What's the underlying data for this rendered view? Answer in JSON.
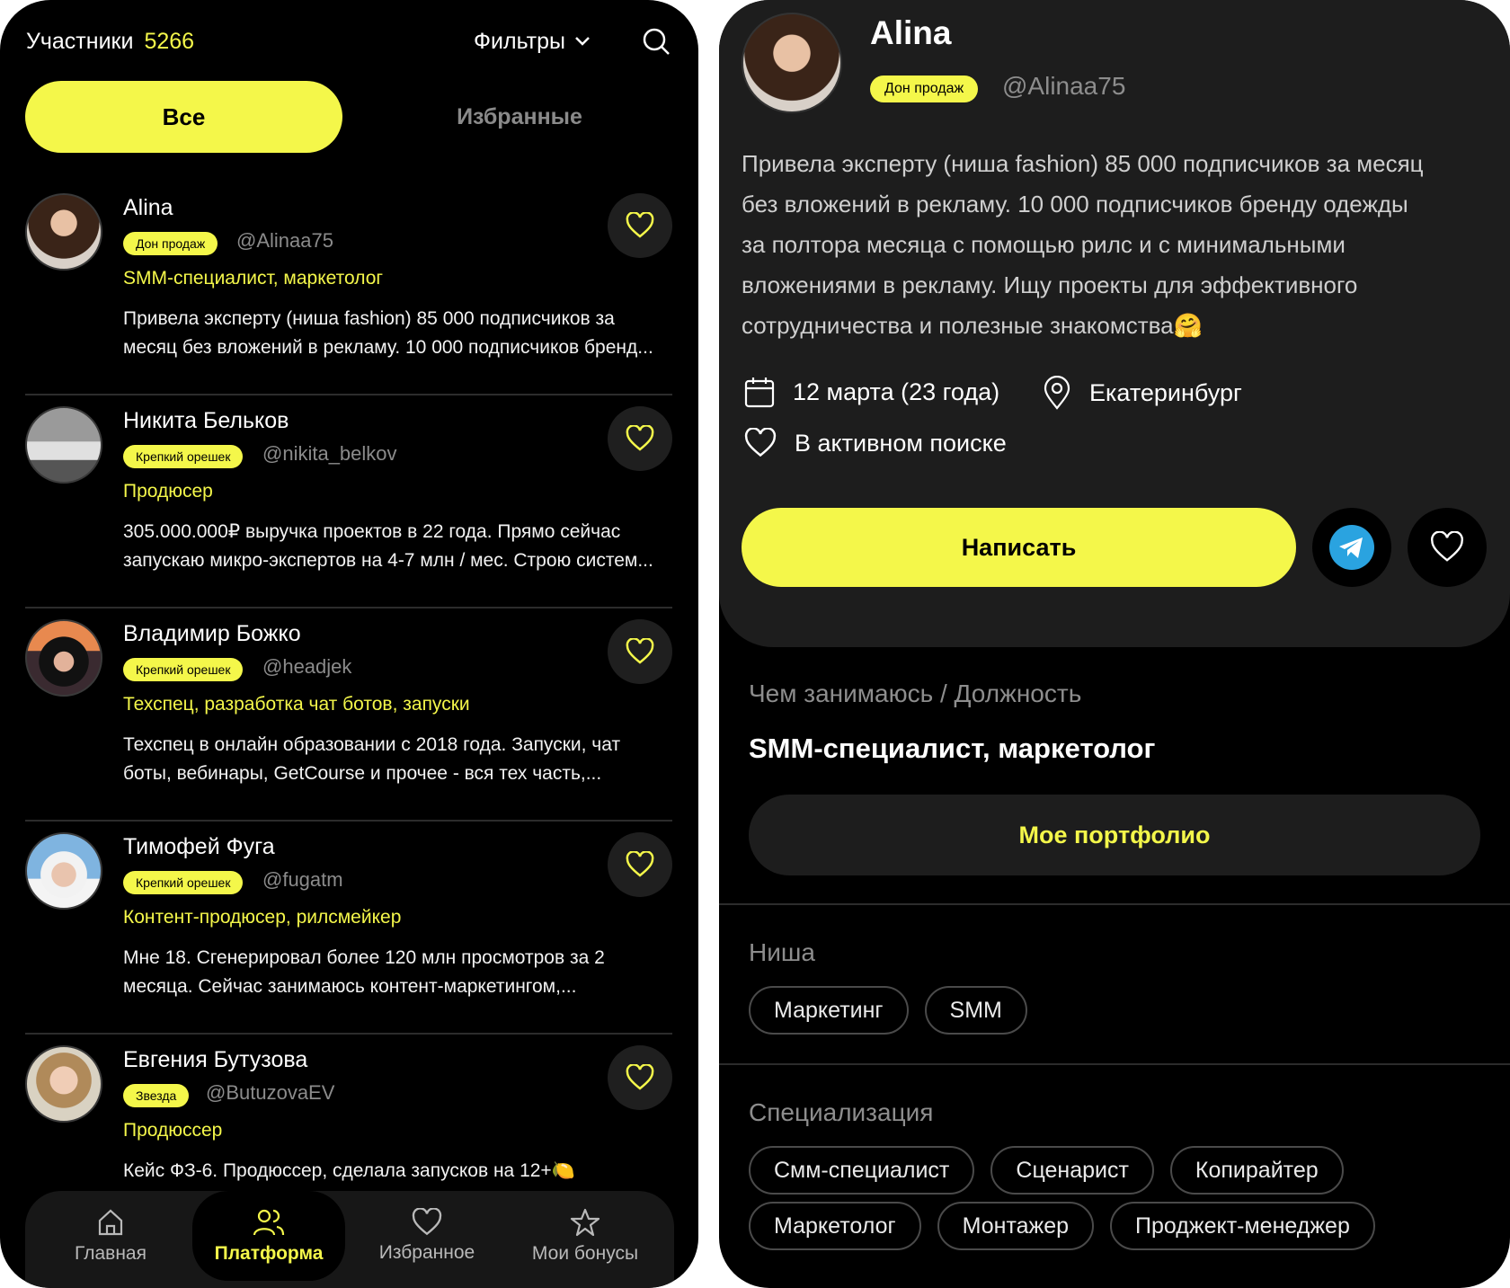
{
  "left": {
    "header": {
      "title": "Участники",
      "count": "5266",
      "filters_label": "Фильтры"
    },
    "segments": {
      "all": "Все",
      "favorites": "Избранные"
    },
    "members": [
      {
        "name": "Alina",
        "badge": "Дон продаж",
        "handle": "@Alinaa75",
        "role": "SMM-специалист, маркетолог",
        "desc1": "Привела эксперту (ниша fashion) 85 000 подписчиков за",
        "desc2": "месяц без вложений в рекламу. 10 000 подписчиков бренд..."
      },
      {
        "name": "Никита Бельков",
        "badge": "Крепкий орешек",
        "handle": "@nikita_belkov",
        "role": "Продюсер",
        "desc1": "305.000.000₽ выручка проектов в 22 года. Прямо сейчас",
        "desc2": "запускаю микро-экспертов на 4-7 млн / мес. Строю систем..."
      },
      {
        "name": "Владимир Божко",
        "badge": "Крепкий орешек",
        "handle": "@headjek",
        "role": "Техспец, разработка чат ботов, запуски",
        "desc1": "Техспец в онлайн образовании с 2018 года. Запуски, чат",
        "desc2": "боты, вебинары, GetCourse и прочее - вся тех часть,..."
      },
      {
        "name": "Тимофей Фуга",
        "badge": "Крепкий орешек",
        "handle": "@fugatm",
        "role": "Контент-продюсер, рилсмейкер",
        "desc1": "Мне 18. Сгенерировал более 120 млн просмотров за 2",
        "desc2": "месяца. Сейчас занимаюсь контент-маркетингом,..."
      },
      {
        "name": "Евгения Бутузова",
        "badge": "Звезда",
        "handle": "@ButuzovaEV",
        "role": "Продюссер",
        "desc1": "Кейс ФЗ-6. Продюссер, сделала запусков на 12+🍋",
        "desc2": ""
      }
    ],
    "tabbar": [
      {
        "label": "Главная",
        "icon": "home-icon"
      },
      {
        "label": "Платформа",
        "icon": "users-icon"
      },
      {
        "label": "Избранное",
        "icon": "heart-icon"
      },
      {
        "label": "Мои бонусы",
        "icon": "star-icon"
      }
    ]
  },
  "right": {
    "profile": {
      "name": "Alina",
      "badge": "Дон продаж",
      "handle": "@Alinaa75",
      "bio1": "Привела эксперту (ниша fashion) 85 000 подписчиков за месяц",
      "bio2": "без вложений в рекламу. 10 000 подписчиков бренду одежды",
      "bio3": "за полтора месяца с помощью рилс и с минимальными",
      "bio4": "вложениями в рекламу. Ищу проекты для эффективного",
      "bio5": "сотрудничества и полезные знакомства🤗",
      "birthday": "12 марта (23 года)",
      "city": "Екатеринбург",
      "status": "В активном поиске",
      "write_label": "Написать"
    },
    "occupation": {
      "label": "Чем занимаюсь / Должность",
      "value": "SMM-специалист, маркетолог",
      "portfolio_label": "Мое портфолио"
    },
    "niche": {
      "label": "Ниша",
      "tags": [
        "Маркетинг",
        "SMM"
      ]
    },
    "specialization": {
      "label": "Специализация",
      "tags": [
        "Смм-специалист",
        "Сценарист",
        "Копирайтер",
        "Маркетолог",
        "Монтажер",
        "Проджект-менеджер"
      ]
    }
  },
  "colors": {
    "accent": "#f4f74a",
    "background": "#000000",
    "surface": "#1d1d1d",
    "muted": "#8d8d8d"
  }
}
